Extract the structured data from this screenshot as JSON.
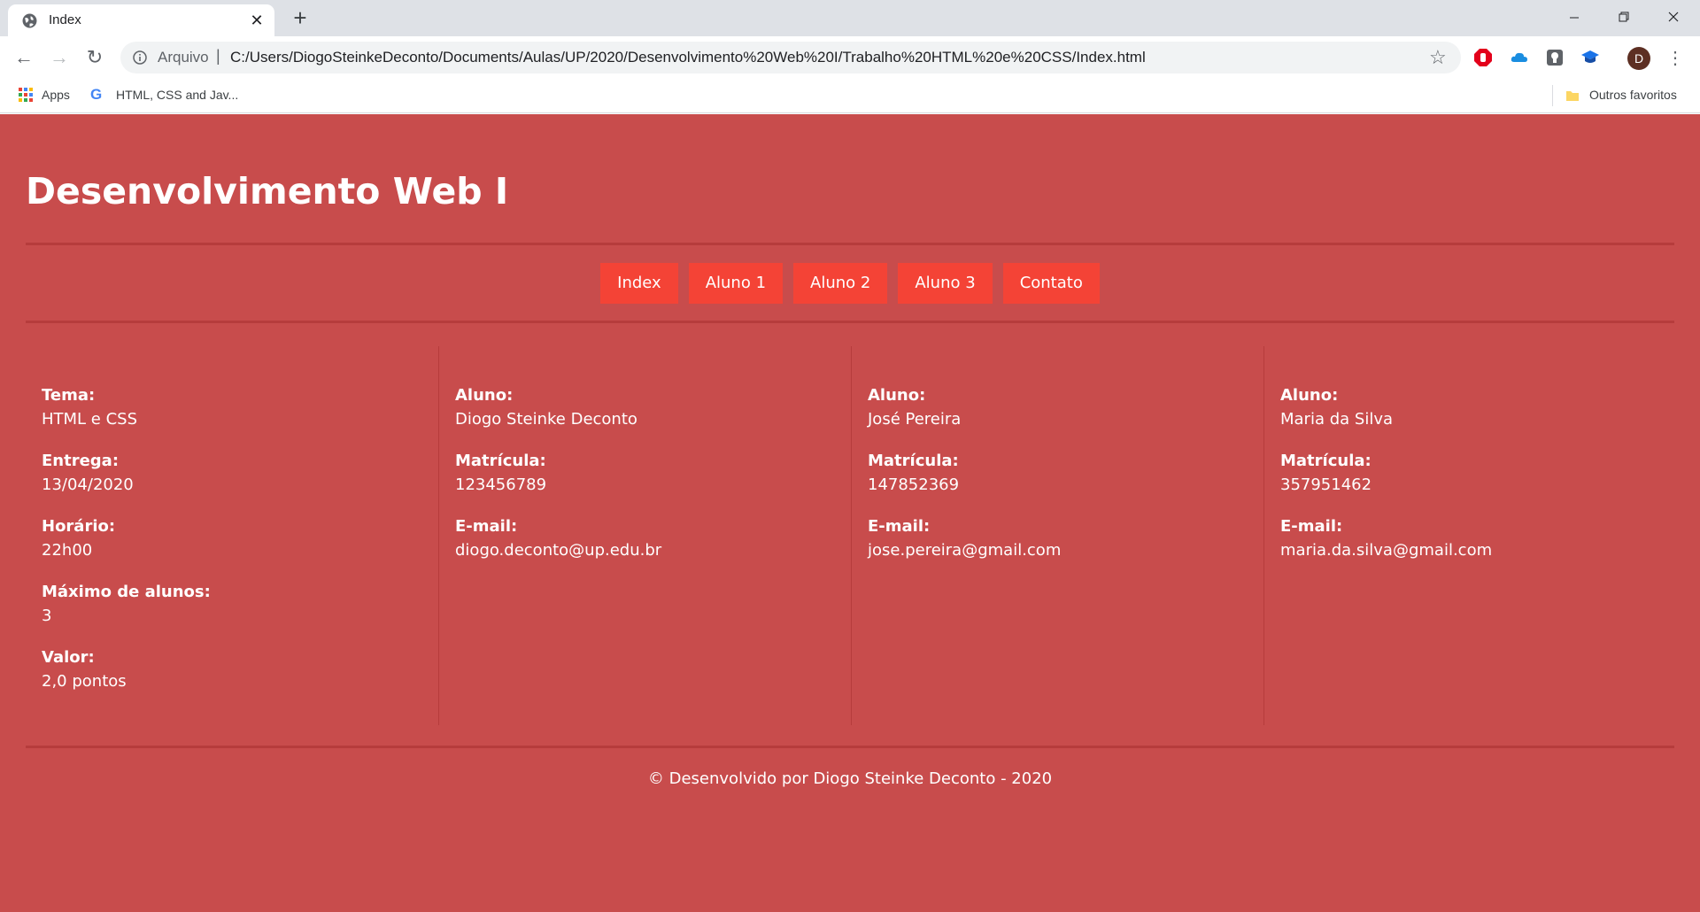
{
  "browser": {
    "tab_title": "Index",
    "new_tab": "+",
    "omnibox": {
      "scheme": "Arquivo",
      "url": "C:/Users/DiogoSteinkeDeconto/Documents/Aulas/UP/2020/Desenvolvimento%20Web%20I/Trabalho%20HTML%20e%20CSS/Index.html"
    },
    "avatar_letter": "D",
    "bookmarks": {
      "apps": "Apps",
      "html_css": "HTML, CSS and Jav...",
      "outros": "Outros favoritos"
    }
  },
  "page": {
    "title": "Desenvolvimento Web I",
    "nav": [
      "Index",
      "Aluno 1",
      "Aluno 2",
      "Aluno 3",
      "Contato"
    ],
    "info": {
      "tema_label": "Tema:",
      "tema": "HTML e CSS",
      "entrega_label": "Entrega:",
      "entrega": "13/04/2020",
      "horario_label": "Horário:",
      "horario": "22h00",
      "maximo_label": "Máximo de alunos:",
      "maximo": "3",
      "valor_label": "Valor:",
      "valor": "2,0 pontos"
    },
    "students": [
      {
        "aluno_label": "Aluno:",
        "nome": "Diogo Steinke Deconto",
        "matricula_label": "Matrícula:",
        "matricula": "123456789",
        "email_label": "E-mail:",
        "email": "diogo.deconto@up.edu.br"
      },
      {
        "aluno_label": "Aluno:",
        "nome": "José Pereira",
        "matricula_label": "Matrícula:",
        "matricula": "147852369",
        "email_label": "E-mail:",
        "email": "jose.pereira@gmail.com"
      },
      {
        "aluno_label": "Aluno:",
        "nome": "Maria da Silva",
        "matricula_label": "Matrícula:",
        "matricula": "357951462",
        "email_label": "E-mail:",
        "email": "maria.da.silva@gmail.com"
      }
    ],
    "footer": "© Desenvolvido por Diogo Steinke Deconto - 2020"
  },
  "colors": {
    "page_bg": "#c84c4c",
    "nav_button": "#f44336",
    "rule": "#b63c3c"
  }
}
